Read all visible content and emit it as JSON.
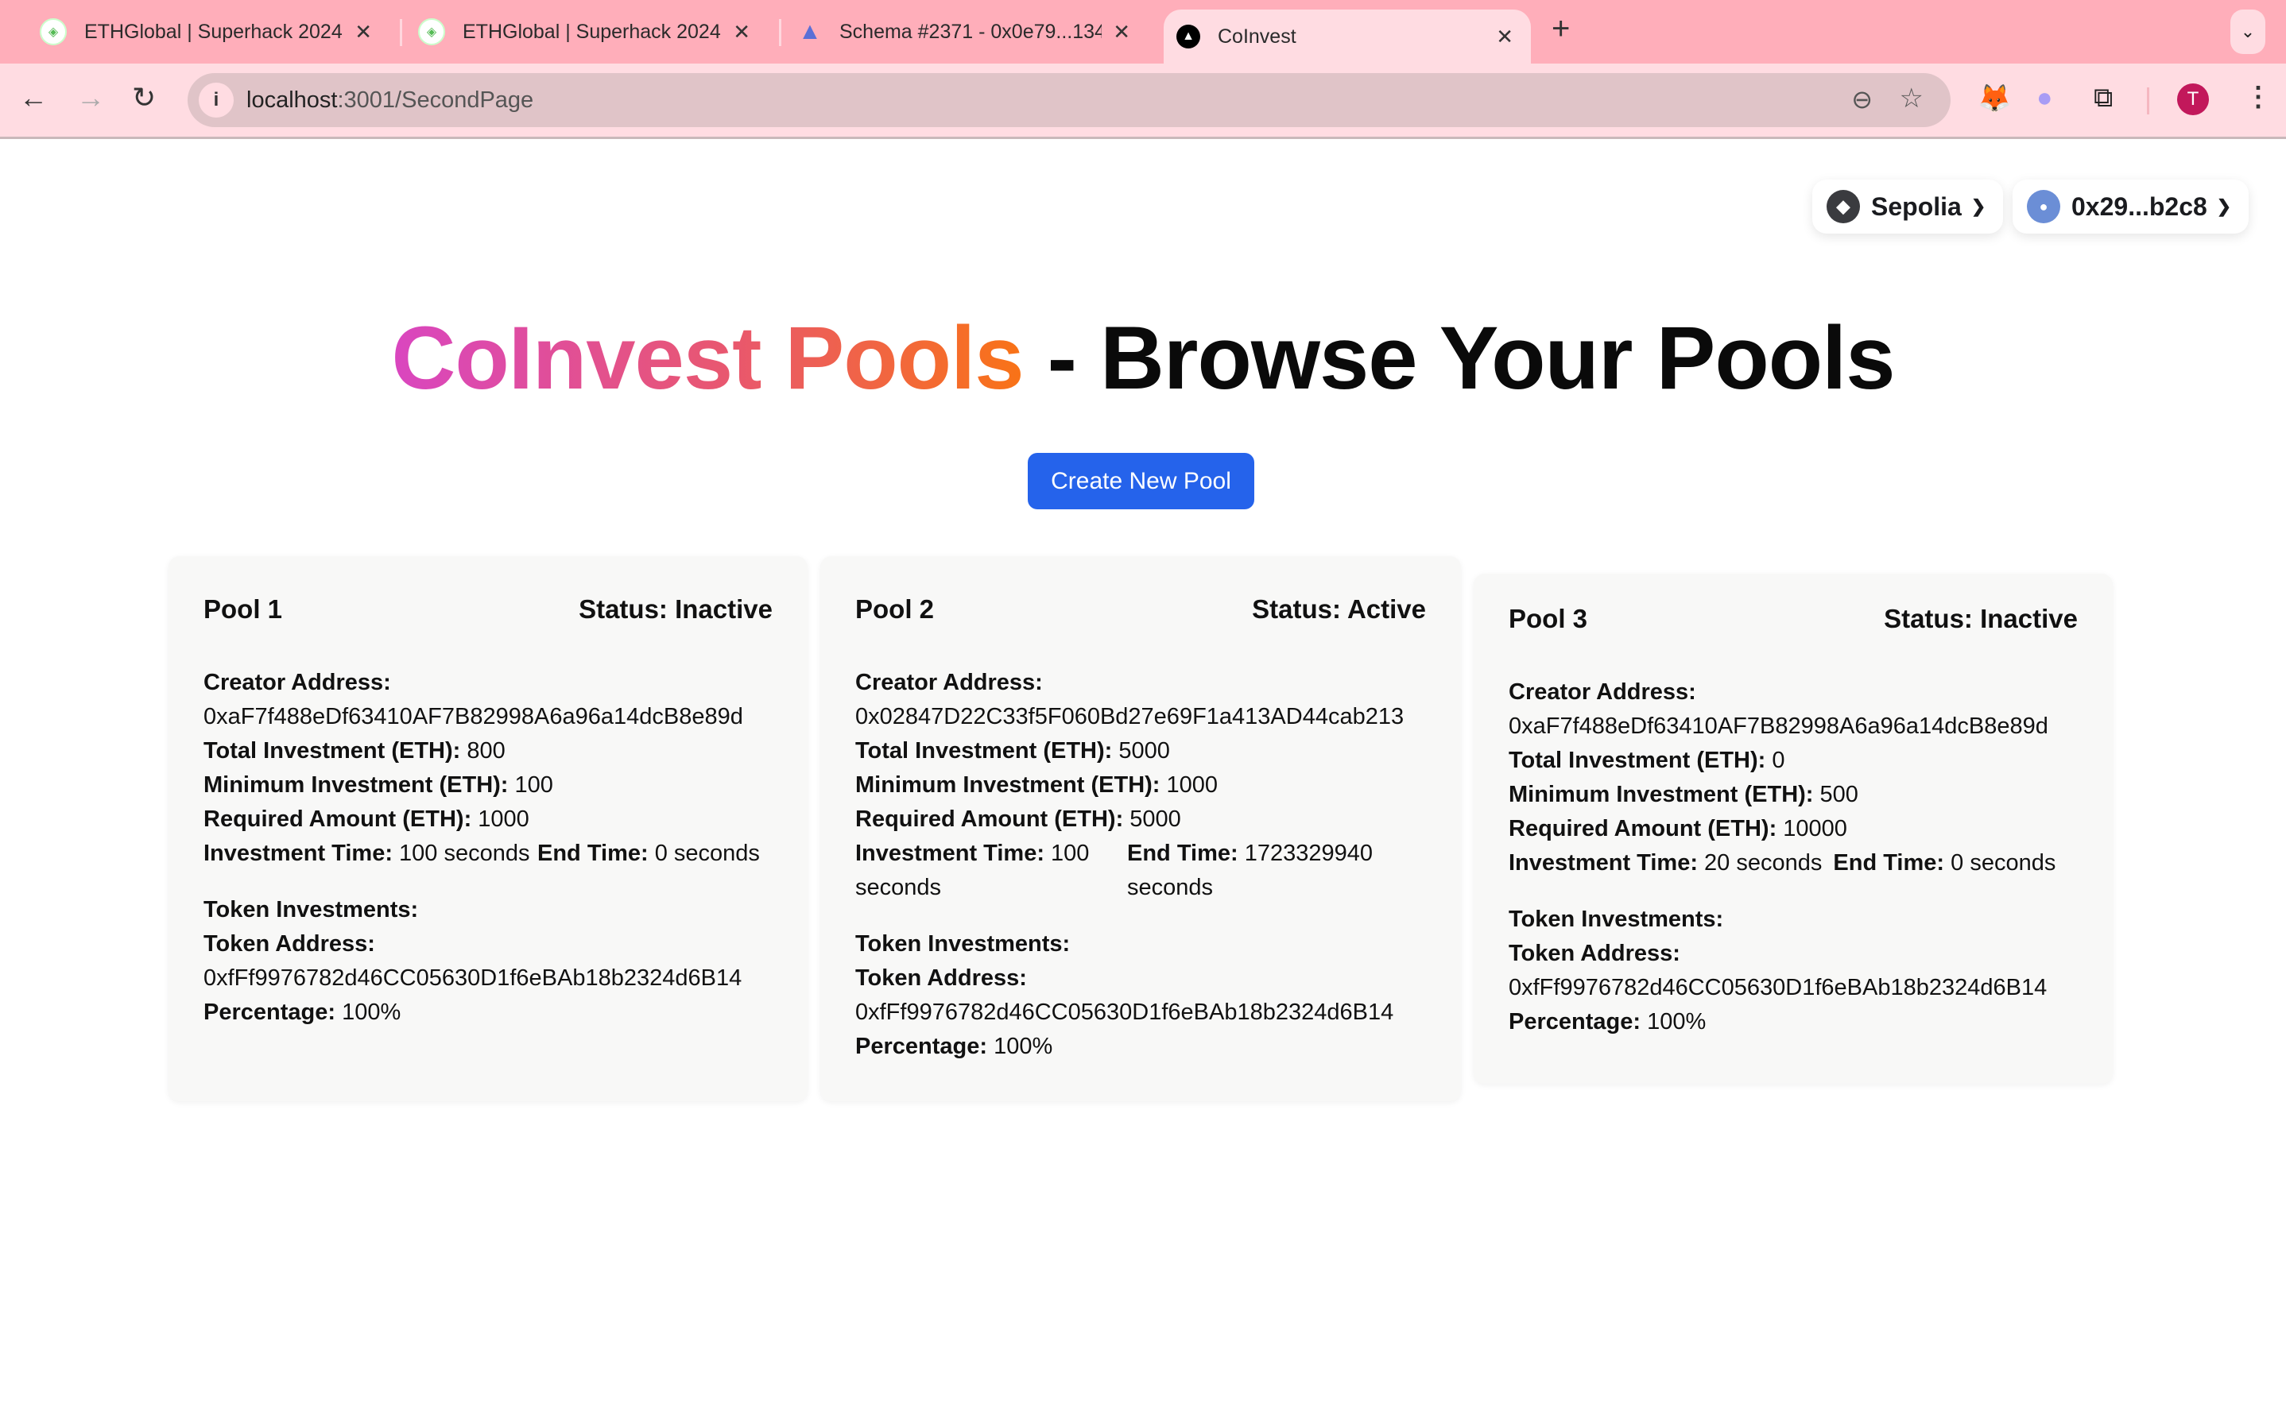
{
  "browser": {
    "tabs": [
      {
        "title": "ETHGlobal | Superhack 2024",
        "icon": "ethglobal-icon",
        "active": false
      },
      {
        "title": "ETHGlobal | Superhack 2024",
        "icon": "ethglobal-icon",
        "active": false
      },
      {
        "title": "Schema #2371 - 0x0e79...134",
        "icon": "eas-icon",
        "active": false
      },
      {
        "title": "CoInvest",
        "icon": "coinvest-icon",
        "active": true
      }
    ],
    "new_tab": "+",
    "close_glyph": "✕",
    "url_host": "localhost",
    "url_rest": ":3001/SecondPage",
    "profile_initial": "T"
  },
  "wallet": {
    "network_label": "Sepolia",
    "account_label": "0x29...b2c8"
  },
  "page": {
    "title_gradient": "CoInvest Pools",
    "title_rest": " - Browse Your Pools",
    "create_button": "Create New Pool",
    "brand_gradient": [
      "#d946c0",
      "#e9586c",
      "#f97316"
    ],
    "button_color": "#2563eb"
  },
  "labels": {
    "creator": "Creator Address:",
    "total": "Total Investment (ETH):",
    "minimum": "Minimum Investment (ETH):",
    "required": "Required Amount (ETH):",
    "inv_time": "Investment Time:",
    "end_time": "End Time:",
    "token_investments": "Token Investments:",
    "token_address": "Token Address:",
    "percentage": "Percentage:"
  },
  "pools": [
    {
      "name": "Pool 1",
      "status": "Status: Inactive",
      "creator": "0xaF7f488eDf63410AF7B82998A6a96a14dcB8e89d",
      "total": "800",
      "minimum": "100",
      "required": "1000",
      "inv_time_value": "100",
      "inv_time_unit": "seconds",
      "end_time_value": "0",
      "end_time_unit": "seconds",
      "token_address": "0xfFf9976782d46CC05630D1f6eBAb18b2324d6B14",
      "percentage": "100%"
    },
    {
      "name": "Pool 2",
      "status": "Status: Active",
      "creator": "0x02847D22C33f5F060Bd27e69F1a413AD44cab213",
      "total": "5000",
      "minimum": "1000",
      "required": "5000",
      "inv_time_value": "100",
      "inv_time_unit": "seconds",
      "end_time_value": "1723329940",
      "end_time_unit": "seconds",
      "token_address": "0xfFf9976782d46CC05630D1f6eBAb18b2324d6B14",
      "percentage": "100%"
    },
    {
      "name": "Pool 3",
      "status": "Status: Inactive",
      "creator": "0xaF7f488eDf63410AF7B82998A6a96a14dcB8e89d",
      "total": "0",
      "minimum": "500",
      "required": "10000",
      "inv_time_value": "20",
      "inv_time_unit": "seconds",
      "end_time_value": "0",
      "end_time_unit": "seconds",
      "token_address": "0xfFf9976782d46CC05630D1f6eBAb18b2324d6B14",
      "percentage": "100%"
    }
  ]
}
